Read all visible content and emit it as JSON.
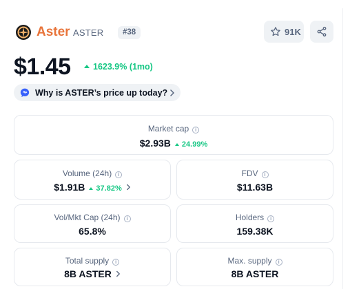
{
  "coin": {
    "name": "Aster",
    "symbol": "ASTER",
    "rank": "#38",
    "logo_icon": "aster-logo-icon",
    "brand_color": "#e8743a"
  },
  "watchlist": {
    "icon": "star-icon",
    "count": "91K"
  },
  "share": {
    "icon": "share-icon"
  },
  "price": {
    "value": "$1.45",
    "change": "1623.9% (1mo)",
    "change_color": "#16c784"
  },
  "why_pill": {
    "icon": "ai-sparkle-icon",
    "text": "Why is ASTER’s price up today?"
  },
  "stats": {
    "market_cap": {
      "label": "Market cap",
      "value": "$2.93B",
      "change": "24.99%"
    },
    "volume": {
      "label": "Volume (24h)",
      "value": "$1.91B",
      "change": "37.82%"
    },
    "fdv": {
      "label": "FDV",
      "value": "$11.63B"
    },
    "vol_mkt_cap": {
      "label": "Vol/Mkt Cap (24h)",
      "value": "65.8%"
    },
    "holders": {
      "label": "Holders",
      "value": "159.38K"
    },
    "total_supply": {
      "label": "Total supply",
      "value": "8B ASTER"
    },
    "max_supply": {
      "label": "Max. supply",
      "value": "8B ASTER"
    }
  }
}
